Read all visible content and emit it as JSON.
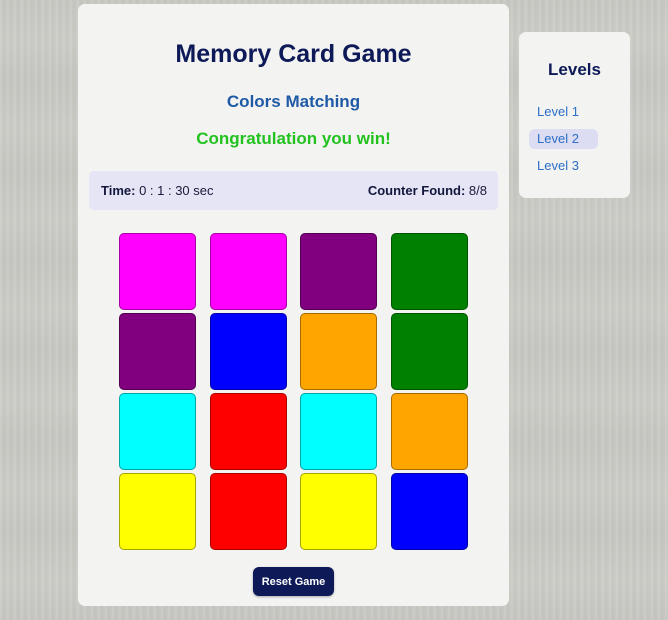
{
  "game": {
    "title": "Memory Card Game",
    "subtitle": "Colors Matching",
    "status_message": "Congratulation you win!",
    "time_label": "Time:",
    "time_value": "0 : 1 : 30 sec",
    "counter_label": "Counter Found:",
    "counter_value": "8/8",
    "reset_label": "Reset Game",
    "cards": [
      {
        "color": "#ff00ff"
      },
      {
        "color": "#ff00ff"
      },
      {
        "color": "#800080"
      },
      {
        "color": "#008000"
      },
      {
        "color": "#800080"
      },
      {
        "color": "#0000ff"
      },
      {
        "color": "#ffa500"
      },
      {
        "color": "#008000"
      },
      {
        "color": "#00ffff"
      },
      {
        "color": "#ff0000"
      },
      {
        "color": "#00ffff"
      },
      {
        "color": "#ffa500"
      },
      {
        "color": "#ffff00"
      },
      {
        "color": "#ff0000"
      },
      {
        "color": "#ffff00"
      },
      {
        "color": "#0000ff"
      }
    ]
  },
  "levels": {
    "title": "Levels",
    "items": [
      {
        "label": "Level 1",
        "active": false
      },
      {
        "label": "Level 2",
        "active": true
      },
      {
        "label": "Level 3",
        "active": false
      }
    ]
  },
  "colors": {
    "accent_dark": "#0e1a57",
    "subtitle_blue": "#1f5aa6",
    "win_green": "#22c21f",
    "stats_bg": "#e5e5f6",
    "link_blue": "#2b6fc7"
  }
}
